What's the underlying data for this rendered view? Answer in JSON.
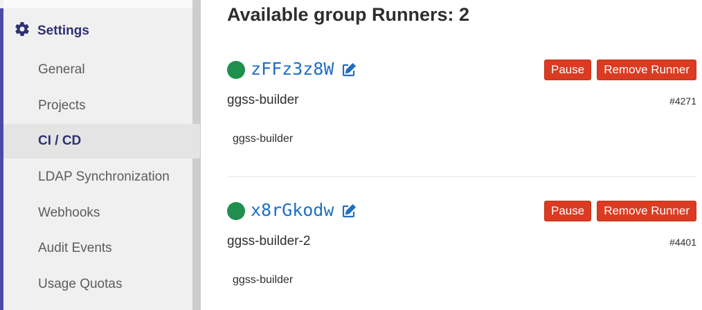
{
  "sidebar": {
    "header_label": "Settings",
    "items": [
      {
        "label": "General"
      },
      {
        "label": "Projects"
      },
      {
        "label": "CI / CD"
      },
      {
        "label": "LDAP Synchronization"
      },
      {
        "label": "Webhooks"
      },
      {
        "label": "Audit Events"
      },
      {
        "label": "Usage Quotas"
      }
    ],
    "active_item": "CI / CD"
  },
  "main": {
    "title": "Available group Runners: 2",
    "runners": [
      {
        "token": "zFFz3z8W",
        "status": "online",
        "status_color": "#1e8f4c",
        "description": "ggss-builder",
        "id": "#4271",
        "tag": "ggss-builder",
        "pause_label": "Pause",
        "remove_label": "Remove Runner"
      },
      {
        "token": "x8rGkodw",
        "status": "online",
        "status_color": "#1e8f4c",
        "description": "ggss-builder-2",
        "id": "#4401",
        "tag": "ggss-builder",
        "pause_label": "Pause",
        "remove_label": "Remove Runner"
      }
    ]
  },
  "colors": {
    "accent": "#4b4ba3",
    "link": "#1f6fc4",
    "danger": "#db3b21"
  }
}
